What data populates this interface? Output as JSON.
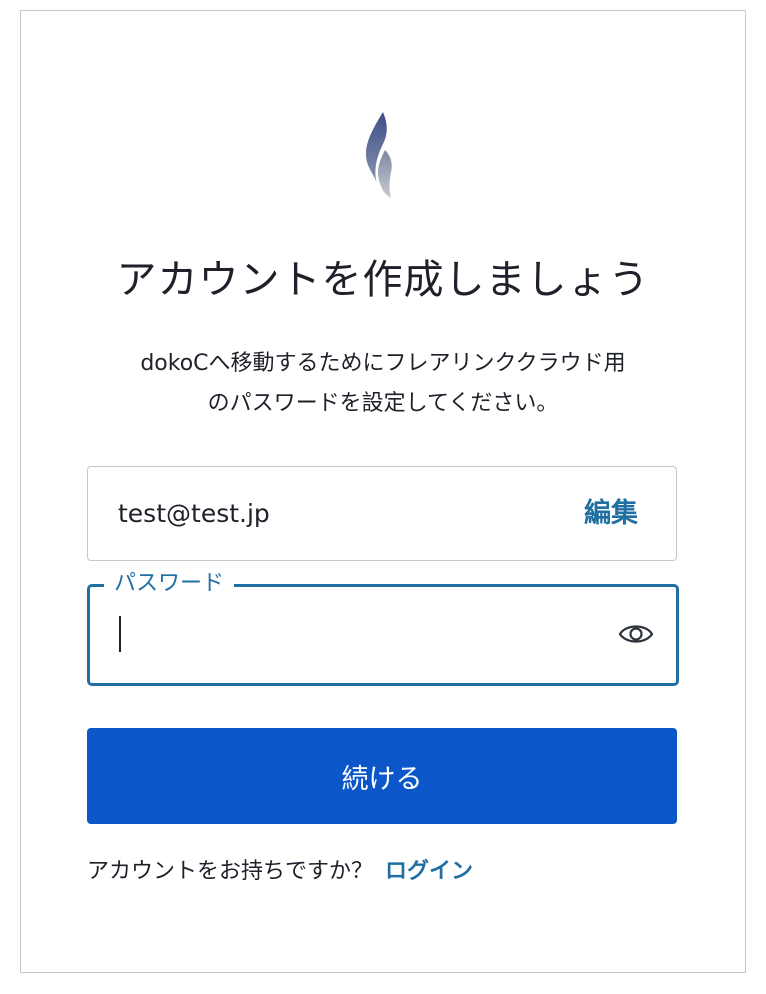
{
  "page": {
    "title": "アカウントを作成しましょう",
    "subtitle_line1": "dokoCへ移動するためにフレアリンククラウド用",
    "subtitle_line2": "のパスワードを設定してください。"
  },
  "email": {
    "value": "test@test.jp",
    "edit_label": "編集"
  },
  "password": {
    "label": "パスワード",
    "value": "",
    "toggle_icon": "eye-icon"
  },
  "actions": {
    "continue_label": "続ける"
  },
  "footer": {
    "prompt": "アカウントをお持ちですか？",
    "login_label": "ログイン"
  },
  "colors": {
    "accent": "#1f6fa3",
    "primary_button": "#0b57c9",
    "border": "#c2c8d0",
    "text": "#1e212a"
  }
}
